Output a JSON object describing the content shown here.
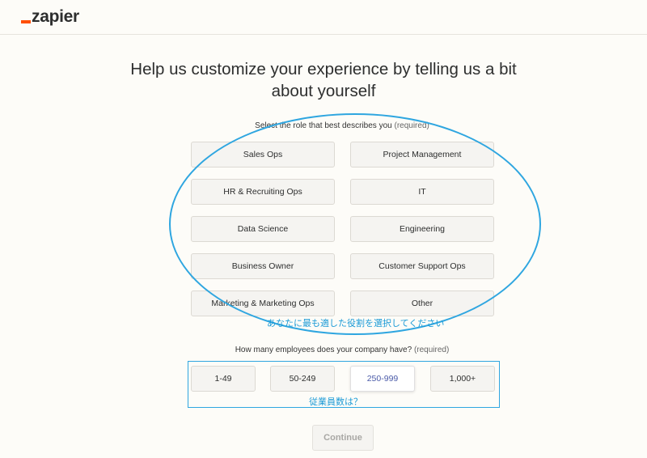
{
  "header": {
    "logo_text": "zapier",
    "brand_color": "#ff4f00"
  },
  "headline": "Help us customize your experience by telling us a bit about yourself",
  "roles": {
    "label": "Select the role that best describes you",
    "required": "(required)",
    "options": [
      "Sales Ops",
      "Project Management",
      "HR & Recruiting Ops",
      "IT",
      "Data Science",
      "Engineering",
      "Business Owner",
      "Customer Support Ops",
      "Marketing & Marketing Ops",
      "Other"
    ],
    "annotation": "あなたに最も適した役割を選択してください"
  },
  "employees": {
    "label": "How many employees does your company have?",
    "required": "(required)",
    "options": [
      "1-49",
      "50-249",
      "250-999",
      "1,000+"
    ],
    "selected": "250-999",
    "annotation": "従業員数は？"
  },
  "continue_label": "Continue",
  "annotation_color": "#2fa6e0"
}
